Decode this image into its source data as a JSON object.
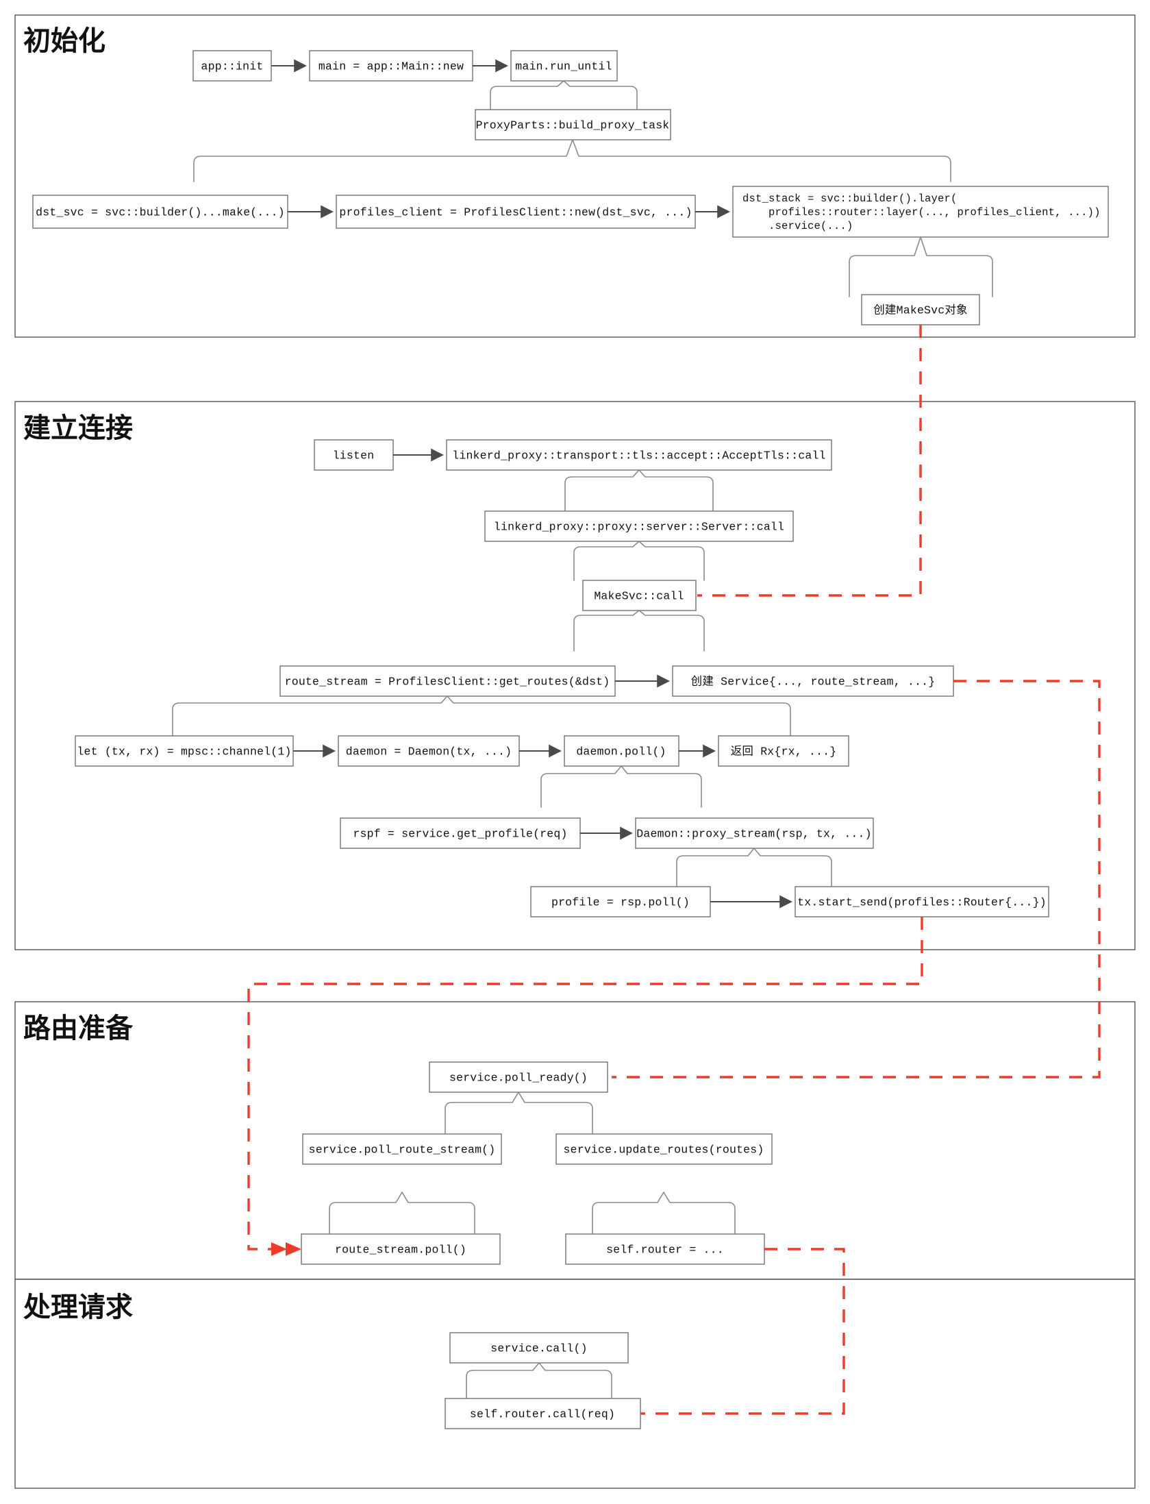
{
  "diagram": {
    "title_font_color": "#111111",
    "accent_red": "#ef3b2c",
    "frame_color": "#6b6b6b",
    "sections": [
      {
        "id": "init",
        "label": "初始化"
      },
      {
        "id": "connect",
        "label": "建立连接"
      },
      {
        "id": "route",
        "label": "路由准备"
      },
      {
        "id": "request",
        "label": "处理请求"
      }
    ],
    "nodes": {
      "app_init": "app::init",
      "main_new": "main = app::Main::new",
      "main_run_until": "main.run_until",
      "build_proxy_task": "ProxyParts::build_proxy_task",
      "dst_svc": "dst_svc = svc::builder()...make(...)",
      "profiles_client": "profiles_client = ProfilesClient::new(dst_svc, ...)",
      "dst_stack_l1": "dst_stack = svc::builder().layer(",
      "dst_stack_l2": "    profiles::router::layer(..., profiles_client, ...))",
      "dst_stack_l3": "    .service(...)",
      "make_svc_obj": "创建MakeSvc对象",
      "listen": "listen",
      "accept_tls_call": "linkerd_proxy::transport::tls::accept::AcceptTls::call",
      "server_call": "linkerd_proxy::proxy::server::Server::call",
      "makesvc_call": "MakeSvc::call",
      "get_routes": "route_stream = ProfilesClient::get_routes(&dst)",
      "create_service": "创建 Service{..., route_stream, ...}",
      "mpsc_channel": "let (tx, rx) = mpsc::channel(1)",
      "daemon_new": "daemon = Daemon(tx, ...)",
      "daemon_poll": "daemon.poll()",
      "return_rx": "返回 Rx{rx, ...}",
      "get_profile": "rspf = service.get_profile(req)",
      "proxy_stream": "Daemon::proxy_stream(rsp, tx, ...)",
      "profile_rsp_poll": "profile = rsp.poll()",
      "tx_start_send": "tx.start_send(profiles::Router{...})",
      "poll_ready": "service.poll_ready()",
      "poll_route_stream": "service.poll_route_stream()",
      "update_routes": "service.update_routes(routes)",
      "route_stream_poll": "route_stream.poll()",
      "self_router_assign": "self.router = ...",
      "service_call": "service.call()",
      "self_router_call": "self.router.call(req)"
    }
  }
}
